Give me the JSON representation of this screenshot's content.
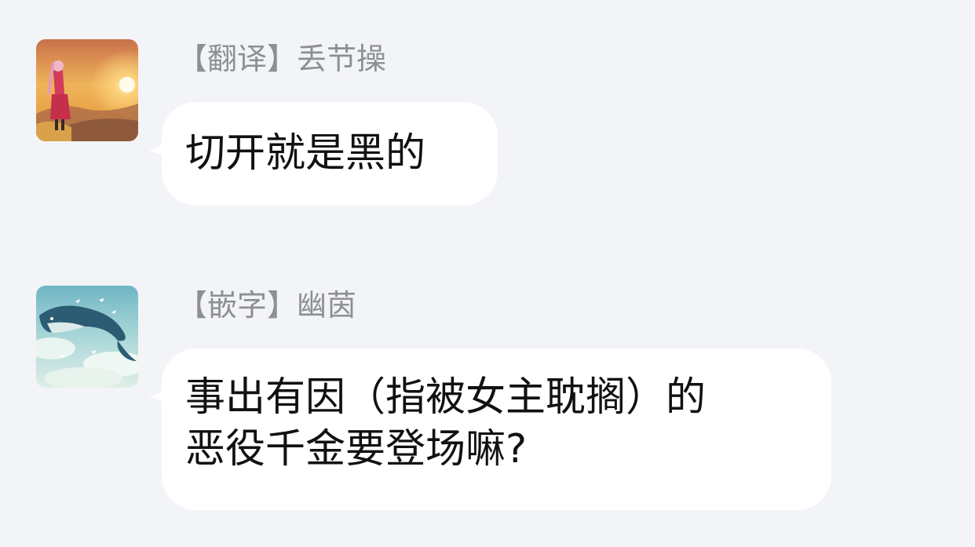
{
  "chat": {
    "messages": [
      {
        "avatar": "avatar-sunset-girl",
        "sender": "【翻译】丢节操",
        "lines": [
          "切开就是黑的"
        ]
      },
      {
        "avatar": "avatar-sky-whale",
        "sender": "【嵌字】幽茵",
        "lines": [
          "事出有因（指被女主耽搁）的",
          "恶役千金要登场嘛?"
        ]
      }
    ]
  },
  "colors": {
    "background": "#f3f4f8",
    "bubble": "#ffffff",
    "sender_text": "#8d8f95",
    "message_text": "#111111"
  }
}
